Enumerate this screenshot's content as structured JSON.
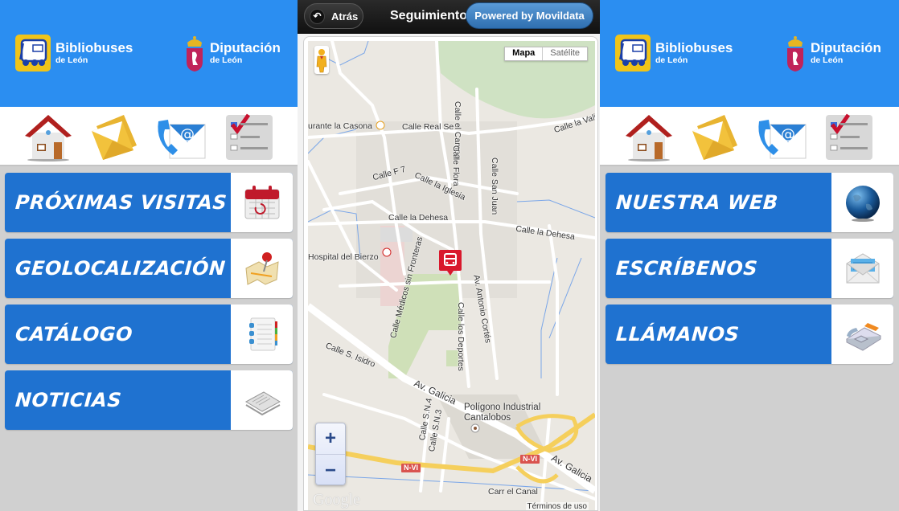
{
  "branding": {
    "bibliobuses_title": "Bibliobuses",
    "bibliobuses_sub": "de León",
    "diputacion_title": "Diputación",
    "diputacion_sub": "de León",
    "header_color": "#2b8ef1",
    "menu_color": "#1f72d0"
  },
  "iconbar": {
    "icons": [
      "home-icon",
      "mail-icon",
      "contact-icon",
      "checklist-icon"
    ]
  },
  "screen1": {
    "menu": [
      {
        "label": "PRÓXIMAS VISITAS",
        "icon": "calendar-icon"
      },
      {
        "label": "GEOLOCALIZACIÓN",
        "icon": "map-pin-icon"
      },
      {
        "label": "CATÁLOGO",
        "icon": "notebook-icon"
      },
      {
        "label": "NOTICIAS",
        "icon": "newspaper-icon"
      }
    ]
  },
  "screen2": {
    "back_label": "Atrás",
    "title": "Seguimiento",
    "powered_label": "Powered by Movildata",
    "map": {
      "type_options": [
        "Mapa",
        "Satélite"
      ],
      "selected_type": "Mapa",
      "zoom_in": "+",
      "zoom_out": "−",
      "attribution": "Google",
      "terms": "Términos de uso",
      "labels": {
        "casona": "urante la Casona",
        "real": "Calle Real Se",
        "campo": "Calle el Campo",
        "vali": "Calle la Vali",
        "f7": "Calle F 7",
        "iglesia": "Calle la Iglesia",
        "flora": "Calle Flora",
        "sanjuan": "Calle San Juan",
        "dehesa1": "Calle la Dehesa",
        "dehesa2": "Calle la Dehesa",
        "hospital": "Hospital del Bierzo",
        "medicos": "Calle Médicos sin Fronteras",
        "cortes": "Av. Antonio Cortés",
        "deportes": "Calle los Deportes",
        "isidro": "Calle S. Isidro",
        "galicia1": "Av. Galicia",
        "galicia2": "Av. Galicia",
        "poligono1": "Polígono Industrial",
        "poligono2": "Cantalobos",
        "sn4": "Calle S.N.4",
        "sn3": "Calle S.N.3",
        "canal": "Carr el Canal",
        "nvi": "N-VI"
      }
    }
  },
  "screen3": {
    "menu": [
      {
        "label": "NUESTRA WEB",
        "icon": "globe-icon"
      },
      {
        "label": "ESCRÍBENOS",
        "icon": "envelope-icon"
      },
      {
        "label": "LLÁMANOS",
        "icon": "telephone-icon"
      }
    ]
  }
}
